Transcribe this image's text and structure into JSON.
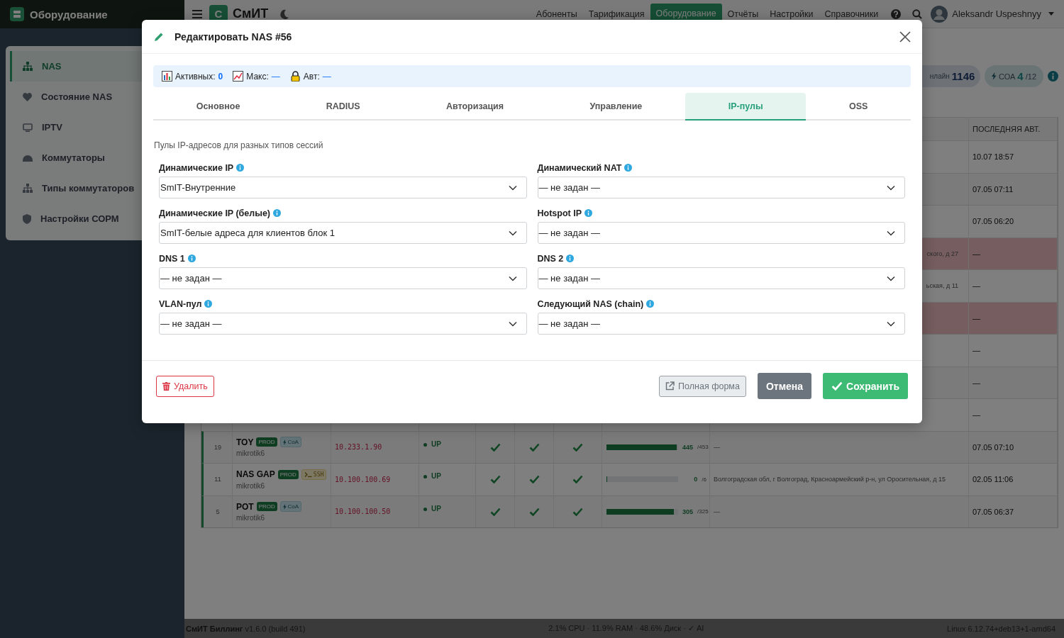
{
  "sidebar": {
    "title": "Оборудование",
    "items": [
      {
        "label": "NAS",
        "selected": true
      },
      {
        "label": "Состояние NAS",
        "selected": false
      },
      {
        "label": "IPTV",
        "selected": false
      },
      {
        "label": "Коммутаторы",
        "selected": false
      },
      {
        "label": "Типы коммутаторов",
        "selected": false
      },
      {
        "label": "Настройки СОРМ",
        "selected": false
      }
    ]
  },
  "topbar": {
    "logo": "С",
    "brand": "СмИТ",
    "user": "Aleksandr Uspeshnyy",
    "nav": [
      {
        "label": "Абоненты",
        "selected": false
      },
      {
        "label": "Тарификация",
        "selected": false
      },
      {
        "label": "Оборудование",
        "selected": true
      },
      {
        "label": "Отчёты",
        "selected": false
      },
      {
        "label": "Настройки",
        "selected": false
      },
      {
        "label": "Справочники",
        "selected": false
      }
    ]
  },
  "summary": {
    "online_label": "нлайн",
    "online_count": "1146",
    "coa_label": "СОА",
    "coa_count": "4",
    "coa_total": "/12"
  },
  "table": {
    "last_auth_header": "ПОСЛЕДНЯЯ АВТ.",
    "rows": [
      {
        "alert": false,
        "last_auth": "10.07 18:57"
      },
      {
        "alert": false,
        "last_auth": "07.05 07:11"
      },
      {
        "alert": false,
        "last_auth": "07.05 06:20"
      },
      {
        "alert": true,
        "address": "ского, д 27",
        "last_auth": "—"
      },
      {
        "alert": false,
        "address": "ьская, д 11",
        "last_auth": "—"
      },
      {
        "alert": true,
        "last_auth": "—"
      },
      {
        "alert": false,
        "last_auth": "—"
      },
      {
        "alert": false,
        "last_auth": "—"
      },
      {
        "alert": false,
        "last_auth": "—"
      },
      {
        "alert": false,
        "id": "19",
        "name": "TOY",
        "tags": [
          {
            "kind": "prod",
            "label": "PROD"
          },
          {
            "kind": "coa",
            "label": "CoA"
          }
        ],
        "model": "mikrotik6",
        "ip": "10.233.1.90",
        "online": true,
        "status": "UP",
        "checks": [
          {
            "checked": true
          },
          {
            "checked": true
          },
          {
            "checked": true
          }
        ],
        "level": 0.98,
        "used": "445",
        "total": "/453",
        "address": "—",
        "last_auth": "07.05 07:10"
      },
      {
        "alert": false,
        "id": "11",
        "name": "NAS GAP",
        "tags": [
          {
            "kind": "prod",
            "label": "PROD"
          },
          {
            "kind": "ssh",
            "label": "SSH"
          }
        ],
        "model": "mikrotik6",
        "ip": "10.100.100.69",
        "online": true,
        "status": "UP",
        "checks": [
          {
            "checked": true
          },
          {
            "checked": true
          },
          {
            "checked": true
          }
        ],
        "level": 0,
        "used": "0",
        "total": "/6",
        "address": "Волгоградская обл, г Волгоград, Красноармейский р-н, ул Оросительная, д 15",
        "last_auth": "02.05 11:06"
      },
      {
        "alert": false,
        "id": "5",
        "name": "POT",
        "tags": [
          {
            "kind": "prod",
            "label": "PROD"
          },
          {
            "kind": "coa",
            "label": "CoA"
          }
        ],
        "model": "mikrotik6",
        "ip": "10.100.100.50",
        "online": true,
        "status": "UP",
        "checks": [
          {
            "checked": true
          },
          {
            "checked": true
          },
          {
            "checked": true
          }
        ],
        "level": 0.94,
        "used": "305",
        "total": "/325",
        "address": "—",
        "last_auth": "07.05 06:37"
      }
    ]
  },
  "footer": {
    "app": "**СмИТ Биллинг** v1.6.0 (build 491)",
    "stats": "2.1% CPU · 11.9% RAM · 48.6% Диск · ✓ AI",
    "os": "Linux 6.12.74+deb13+1-amd64"
  },
  "modal": {
    "title": "Редактировать NAS #56",
    "stats": [
      {
        "label": "Активных:",
        "value": "0"
      },
      {
        "label": "Макс:",
        "value": "—"
      },
      {
        "label": "Авт:",
        "value": "—"
      }
    ],
    "tabs": [
      {
        "label": "Основное",
        "selected": false
      },
      {
        "label": "RADIUS",
        "selected": false
      },
      {
        "label": "Авторизация",
        "selected": false
      },
      {
        "label": "Управление",
        "selected": false
      },
      {
        "label": "IP-пулы",
        "selected": true
      },
      {
        "label": "OSS",
        "selected": false
      }
    ],
    "description": "Пулы IP-адресов для разных типов сессий",
    "fields": [
      {
        "label": "Динамические IP",
        "value": "SmIT-Внутренние"
      },
      {
        "label": "Динамический NAT",
        "value": "— не задан —"
      },
      {
        "label": "Динамические IP (белые)",
        "value": "SmIT-белые адреса для клиентов блок 1"
      },
      {
        "label": "Hotspot IP",
        "value": "— не задан —"
      },
      {
        "label": "DNS 1",
        "value": "— не задан —"
      },
      {
        "label": "DNS 2",
        "value": "— не задан —"
      },
      {
        "label": "VLAN-пул",
        "value": "— не задан —"
      },
      {
        "label": "Следующий NAS (chain)",
        "value": "— не задан —"
      }
    ],
    "buttons": [
      {
        "kind": "delete",
        "label": "Удалить"
      },
      {
        "kind": "full_form",
        "label": "Полная форма"
      },
      {
        "kind": "cancel",
        "label": "Отмена"
      },
      {
        "kind": "save",
        "label": "Сохранить"
      }
    ]
  }
}
